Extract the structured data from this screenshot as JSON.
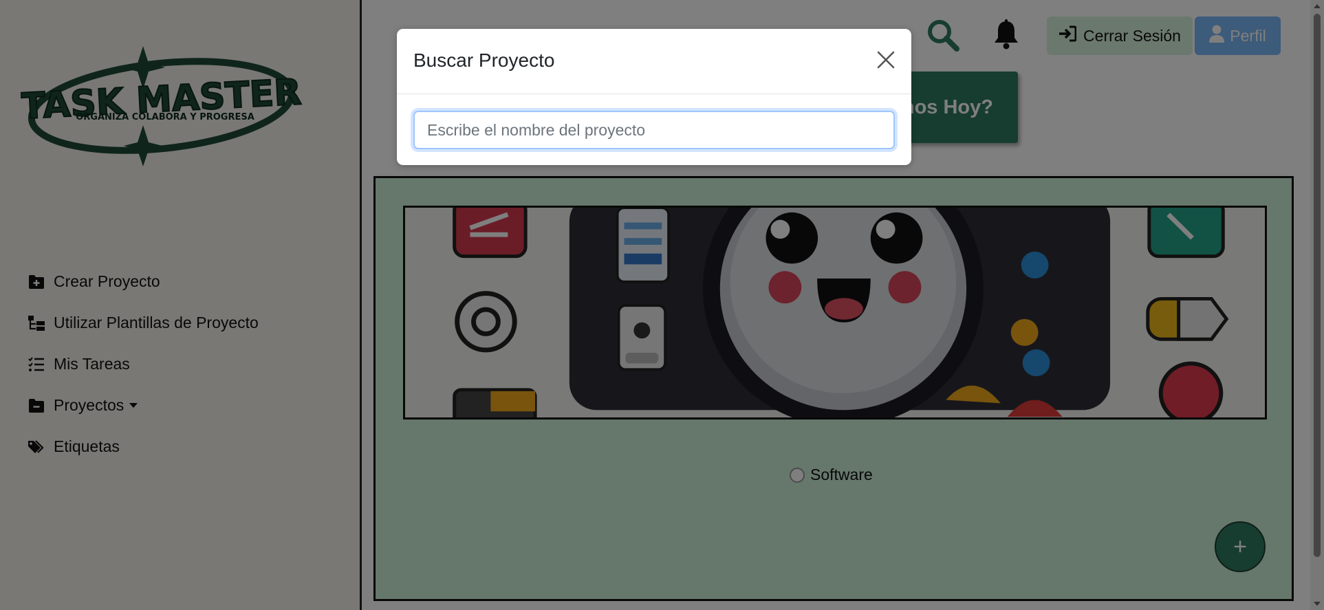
{
  "logo": {
    "title": "TASK MASTER",
    "tagline": "ORGANIZA COLABORA Y PROGRESA"
  },
  "sidebar": {
    "items": [
      {
        "label": "Crear Proyecto",
        "icon": "folder-plus-icon"
      },
      {
        "label": "Utilizar Plantillas de Proyecto",
        "icon": "template-tree-icon"
      },
      {
        "label": "Mis Tareas",
        "icon": "list-check-icon"
      },
      {
        "label": "Proyectos",
        "icon": "folder-minus-icon",
        "dropdown": true
      },
      {
        "label": "Etiquetas",
        "icon": "tags-icon"
      }
    ]
  },
  "topbar": {
    "search_icon": "search-icon",
    "bell_icon": "bell-icon",
    "logout_label": "Cerrar Sesión",
    "profile_label": "Perfil"
  },
  "hero": {
    "button_label": "nos Hoy?"
  },
  "panel": {
    "radio_label": "Software"
  },
  "fab": {
    "label": "+"
  },
  "modal": {
    "title": "Buscar Proyecto",
    "input_value": "",
    "input_placeholder": "Escribe el nombre del proyecto"
  },
  "colors": {
    "brand_green": "#2f7a60",
    "panel_green": "#cdefd8",
    "logout_bg": "#d7f1dc",
    "profile_bg": "#7bb6f5",
    "backdrop": "rgba(0,0,0,0.5)"
  }
}
